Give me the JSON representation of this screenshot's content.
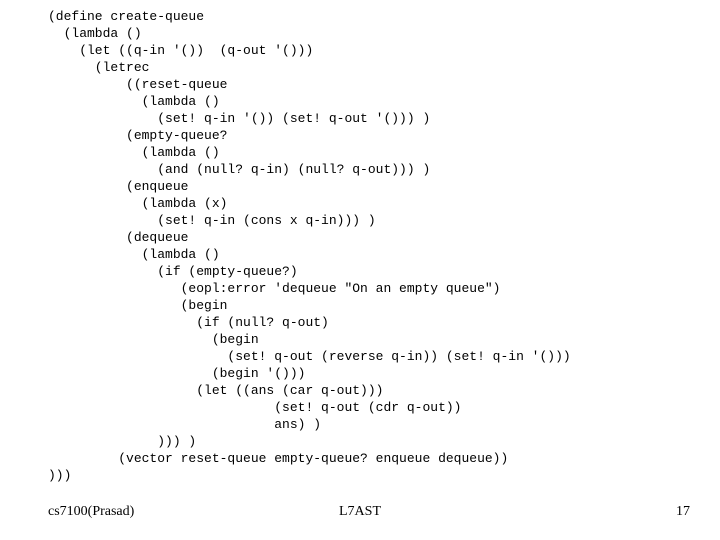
{
  "code": {
    "l1": "(define create-queue",
    "l2": "  (lambda ()",
    "l3": "    (let ((q-in '())  (q-out '()))",
    "l4": "      (letrec",
    "l5": "          ((reset-queue",
    "l6": "            (lambda ()",
    "l7": "              (set! q-in '()) (set! q-out '())) )",
    "l8": "          (empty-queue?",
    "l9": "            (lambda ()",
    "l10": "              (and (null? q-in) (null? q-out))) )",
    "l11": "          (enqueue",
    "l12": "            (lambda (x)",
    "l13": "              (set! q-in (cons x q-in))) )",
    "l14": "          (dequeue",
    "l15": "            (lambda ()",
    "l16": "              (if (empty-queue?)",
    "l17": "                 (eopl:error 'dequeue \"On an empty queue\")",
    "l18": "                 (begin",
    "l19": "                   (if (null? q-out)",
    "l20": "                     (begin",
    "l21": "                       (set! q-out (reverse q-in)) (set! q-in '()))",
    "l22": "                     (begin '()))",
    "l23": "                   (let ((ans (car q-out)))",
    "l24": "                             (set! q-out (cdr q-out))",
    "l25": "                             ans) )",
    "l26": "              ))) )",
    "l27": "         (vector reset-queue empty-queue? enqueue dequeue))",
    "l28": ")))"
  },
  "footer": {
    "left": "cs7100(Prasad)",
    "center": "L7AST",
    "right": "17"
  }
}
